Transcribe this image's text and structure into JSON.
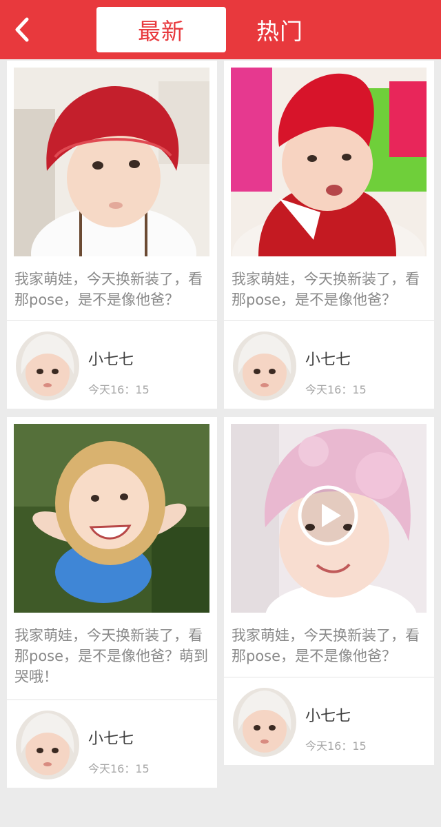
{
  "header": {
    "back_icon": "chevron-left-icon",
    "tabs": [
      {
        "label": "最新",
        "active": true
      },
      {
        "label": "热门",
        "active": false
      }
    ]
  },
  "colors": {
    "brand_red": "#e8393d",
    "background": "#ebebeb",
    "card": "#ffffff"
  },
  "posts": [
    {
      "caption": "我家萌娃，今天换新装了，看那pose，是不是像他爸？",
      "user": "小七七",
      "time": "今天16：15",
      "is_video": false
    },
    {
      "caption": "我家萌娃，今天换新装了，看那pose，是不是像他爸？",
      "user": "小七七",
      "time": "今天16：15",
      "is_video": false
    },
    {
      "caption": "我家萌娃，今天换新装了，看那pose，是不是像他爸？萌到哭哦！",
      "user": "小七七",
      "time": "今天16：15",
      "is_video": false
    },
    {
      "caption": "我家萌娃，今天换新装了，看那pose，是不是像他爸？",
      "user": "小七七",
      "time": "今天16：15",
      "is_video": true,
      "overlay_icon": "play-icon"
    }
  ]
}
